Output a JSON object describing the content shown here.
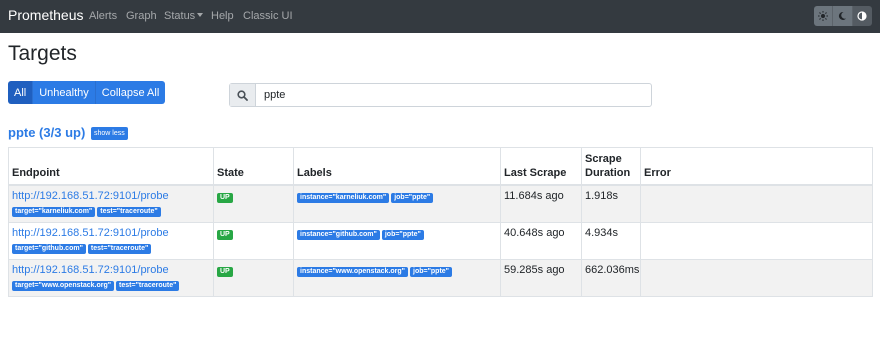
{
  "nav": {
    "brand": "Prometheus",
    "links": [
      "Alerts",
      "Graph",
      "Status",
      "Help",
      "Classic UI"
    ],
    "theme_icons": [
      "sun-icon",
      "moon-icon",
      "contrast-icon"
    ]
  },
  "page": {
    "title": "Targets"
  },
  "filters": {
    "all": "All",
    "unhealthy": "Unhealthy",
    "collapse": "Collapse All"
  },
  "search": {
    "value": "ppte"
  },
  "pool": {
    "title": "ppte (3/3 up)",
    "toggle": "show less"
  },
  "table": {
    "headers": {
      "endpoint": "Endpoint",
      "state": "State",
      "labels": "Labels",
      "last_scrape": "Last Scrape",
      "scrape_duration_1": "Scrape",
      "scrape_duration_2": "Duration",
      "error": "Error"
    },
    "rows": [
      {
        "endpoint": "http://192.168.51.72:9101/probe",
        "params": [
          "target=\"karneliuk.com\"",
          "test=\"traceroute\""
        ],
        "state": "UP",
        "labels": [
          "instance=\"karneliuk.com\"",
          "job=\"ppte\""
        ],
        "last_scrape": "11.684s ago",
        "duration": "1.918s",
        "error": ""
      },
      {
        "endpoint": "http://192.168.51.72:9101/probe",
        "params": [
          "target=\"github.com\"",
          "test=\"traceroute\""
        ],
        "state": "UP",
        "labels": [
          "instance=\"github.com\"",
          "job=\"ppte\""
        ],
        "last_scrape": "40.648s ago",
        "duration": "4.934s",
        "error": ""
      },
      {
        "endpoint": "http://192.168.51.72:9101/probe",
        "params": [
          "target=\"www.openstack.org\"",
          "test=\"traceroute\""
        ],
        "state": "UP",
        "labels": [
          "instance=\"www.openstack.org\"",
          "job=\"ppte\""
        ],
        "last_scrape": "59.285s ago",
        "duration": "662.036ms",
        "error": ""
      }
    ]
  }
}
